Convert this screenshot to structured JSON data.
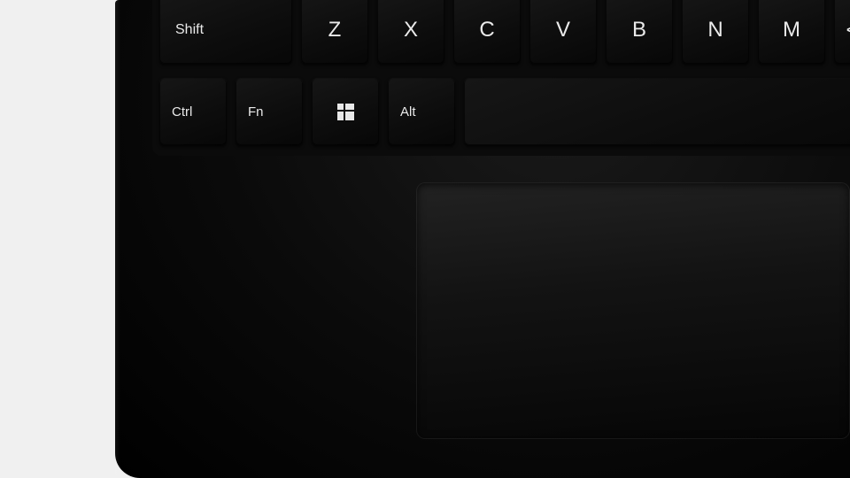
{
  "keys_row_mid": {
    "shift": "Shift",
    "z": "Z",
    "x": "X",
    "c": "C",
    "v": "V",
    "b": "B",
    "n": "N",
    "m": "M",
    "angle": "<"
  },
  "keys_row_bottom": {
    "ctrl": "Ctrl",
    "fn": "Fn",
    "alt": "Alt"
  },
  "icons": {
    "windows": "windows-logo"
  },
  "colors": {
    "keycap": "#131313",
    "legend": "#eaeaea",
    "chassis": "#0a0a0a",
    "background": "#f0f0f0"
  }
}
